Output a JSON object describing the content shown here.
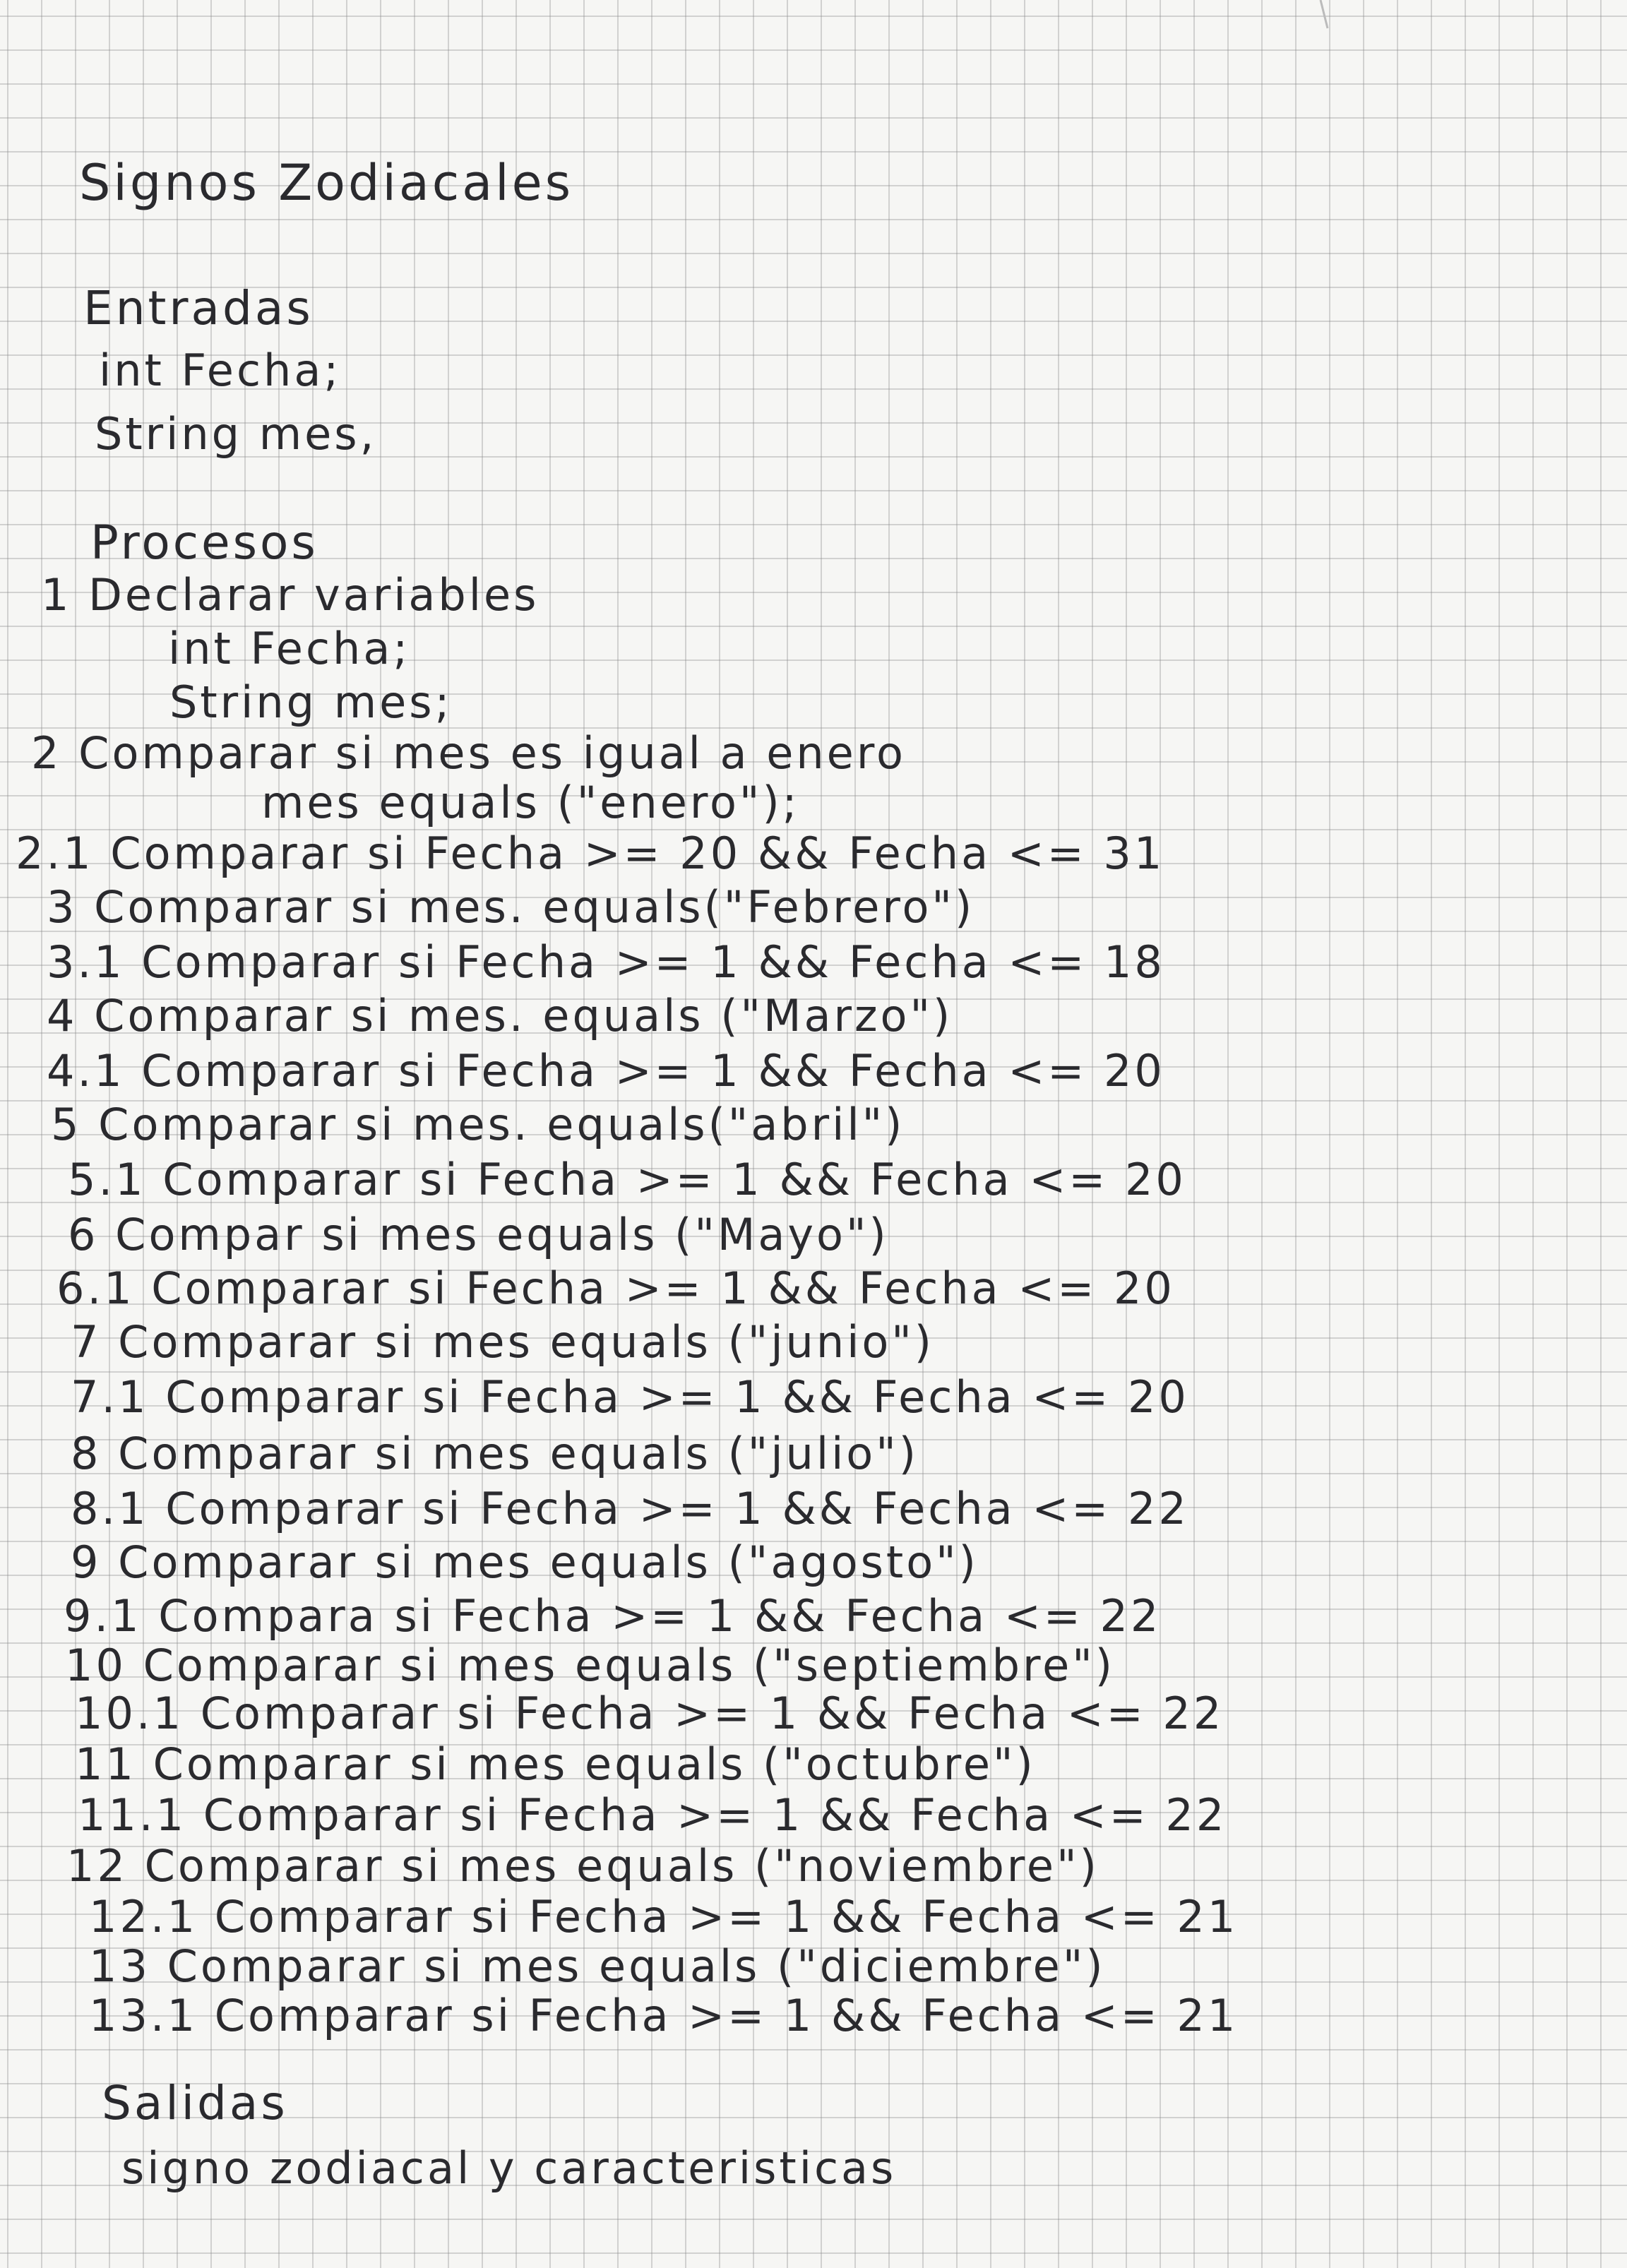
{
  "title": "Signos Zodiacales",
  "entradas": {
    "heading": "Entradas",
    "lines": [
      "int Fecha;",
      "String mes,"
    ]
  },
  "procesos": {
    "heading": "Procesos",
    "steps": [
      "1 Declarar variables",
      "int Fecha;",
      "String mes;",
      "2 Comparar si mes es igual a enero",
      "mes equals (\"enero\");",
      "2.1 Comparar si Fecha >= 20 && Fecha <= 31",
      "3 Comparar si mes. equals(\"Febrero\")",
      "3.1 Comparar si Fecha >= 1 && Fecha <= 18",
      "4 Comparar si mes. equals (\"Marzo\")",
      "4.1 Comparar si Fecha >= 1 && Fecha <= 20",
      "5 Comparar si mes. equals(\"abril\")",
      "5.1 Comparar si Fecha >= 1 && Fecha <= 20",
      "6 Compar si mes equals (\"Mayo\")",
      "6.1 Comparar si Fecha >= 1 && Fecha <= 20",
      "7 Comparar si mes equals (\"junio\")",
      "7.1 Comparar si Fecha >= 1 && Fecha <= 20",
      "8 Comparar si mes equals (\"julio\")",
      "8.1 Comparar si Fecha >= 1 && Fecha <= 22",
      "9 Comparar si mes equals (\"agosto\")",
      "9.1 Compara si Fecha >= 1 && Fecha <= 22",
      "10 Comparar si mes equals (\"septiembre\")",
      "10.1 Comparar si Fecha >= 1 && Fecha <= 22",
      "11 Comparar si mes equals (\"octubre\")",
      "11.1 Comparar si Fecha >= 1 && Fecha <= 22",
      "12 Comparar si mes equals (\"noviembre\")",
      "12.1 Comparar si Fecha >= 1 && Fecha <= 21",
      "13 Comparar si mes equals (\"diciembre\")",
      "13.1 Comparar si Fecha >= 1 && Fecha <= 21"
    ]
  },
  "salidas": {
    "heading": "Salidas",
    "lines": [
      "signo zodiacal y caracteristicas"
    ]
  }
}
